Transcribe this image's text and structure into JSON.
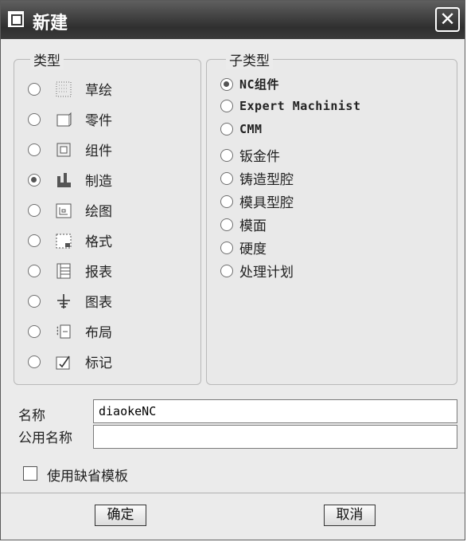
{
  "window": {
    "title": "新建",
    "close_glyph": "✕"
  },
  "type_group": {
    "legend": "类型",
    "items": [
      {
        "label": "草绘",
        "selected": false,
        "icon": "sketch-icon"
      },
      {
        "label": "零件",
        "selected": false,
        "icon": "part-icon"
      },
      {
        "label": "组件",
        "selected": false,
        "icon": "assembly-icon"
      },
      {
        "label": "制造",
        "selected": true,
        "icon": "manufacturing-icon"
      },
      {
        "label": "绘图",
        "selected": false,
        "icon": "drawing-icon"
      },
      {
        "label": "格式",
        "selected": false,
        "icon": "format-icon"
      },
      {
        "label": "报表",
        "selected": false,
        "icon": "report-icon"
      },
      {
        "label": "图表",
        "selected": false,
        "icon": "diagram-icon"
      },
      {
        "label": "布局",
        "selected": false,
        "icon": "layout-icon"
      },
      {
        "label": "标记",
        "selected": false,
        "icon": "markup-icon"
      }
    ]
  },
  "subtype_group": {
    "legend": "子类型",
    "items": [
      {
        "label": "NC组件",
        "selected": true
      },
      {
        "label": "Expert Machinist",
        "selected": false
      },
      {
        "label": "CMM",
        "selected": false
      },
      {
        "label": "钣金件",
        "selected": false
      },
      {
        "label": "铸造型腔",
        "selected": false
      },
      {
        "label": "模具型腔",
        "selected": false
      },
      {
        "label": "模面",
        "selected": false
      },
      {
        "label": "硬度",
        "selected": false
      },
      {
        "label": "处理计划",
        "selected": false
      }
    ]
  },
  "name": {
    "label": "名称",
    "value": "diaokeNC"
  },
  "common_name": {
    "label": "公用名称",
    "value": ""
  },
  "use_default_template": {
    "label": "使用缺省模板",
    "checked": false
  },
  "buttons": {
    "ok": "确定",
    "cancel": "取消"
  }
}
